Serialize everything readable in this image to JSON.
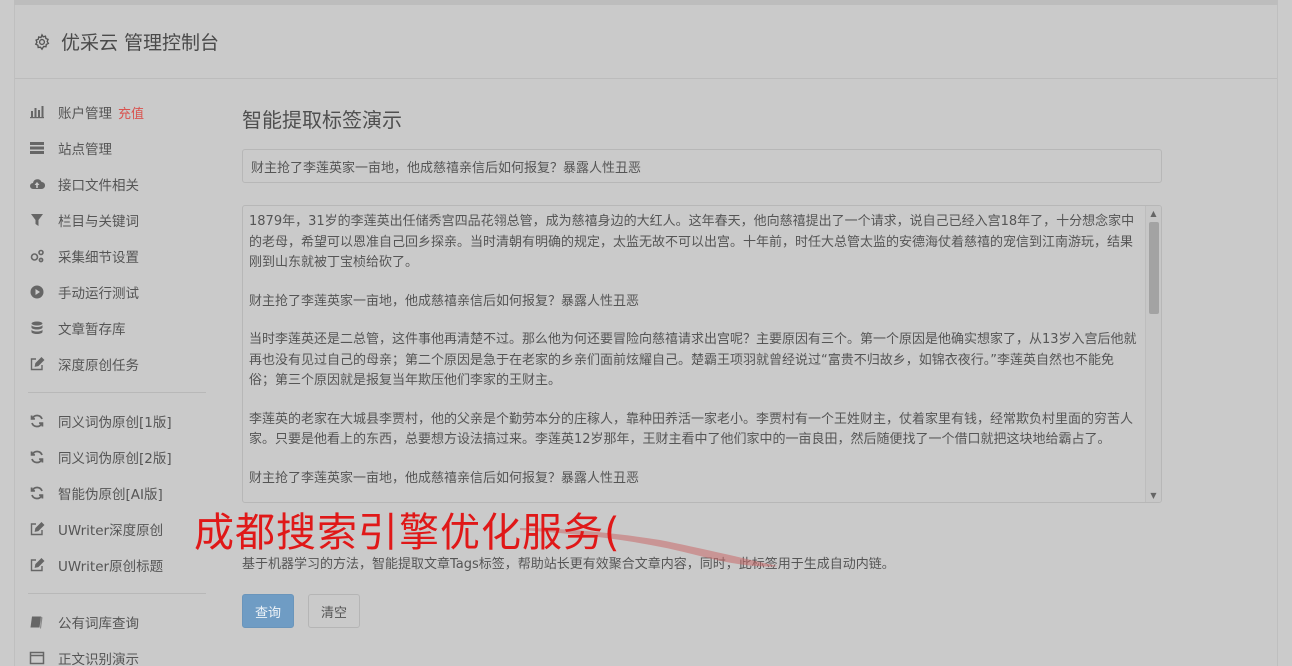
{
  "header": {
    "title": "优采云 管理控制台"
  },
  "sidebar": {
    "group1": [
      {
        "label": "账户管理",
        "badge": "充值",
        "icon": "bar-chart-icon"
      },
      {
        "label": "站点管理",
        "icon": "list-icon"
      },
      {
        "label": "接口文件相关",
        "icon": "cloud-upload-icon"
      },
      {
        "label": "栏目与关键词",
        "icon": "filter-icon"
      },
      {
        "label": "采集细节设置",
        "icon": "gears-icon"
      },
      {
        "label": "手动运行测试",
        "icon": "play-circle-icon"
      },
      {
        "label": "文章暂存库",
        "icon": "database-icon"
      },
      {
        "label": "深度原创任务",
        "icon": "edit-icon"
      }
    ],
    "group2": [
      {
        "label": "同义词伪原创[1版]",
        "icon": "refresh-icon"
      },
      {
        "label": "同义词伪原创[2版]",
        "icon": "refresh-icon"
      },
      {
        "label": "智能伪原创[AI版]",
        "icon": "refresh-icon"
      },
      {
        "label": "UWriter深度原创",
        "icon": "edit-icon"
      },
      {
        "label": "UWriter原创标题",
        "icon": "edit-icon"
      }
    ],
    "group3": [
      {
        "label": "公有词库查询",
        "icon": "book-icon"
      },
      {
        "label": "正文识别演示",
        "icon": "window-icon"
      }
    ]
  },
  "main": {
    "page_title": "智能提取标签演示",
    "title_value": "财主抢了李莲英家一亩地，他成慈禧亲信后如何报复？暴露人性丑恶",
    "content_paragraphs": [
      "1879年，31岁的李莲英出任储秀宫四品花翎总管，成为慈禧身边的大红人。这年春天，他向慈禧提出了一个请求，说自己已经入宫18年了，十分想念家中的老母，希望可以恩准自己回乡探亲。当时清朝有明确的规定，太监无故不可以出宫。十年前，时任大总管太监的安德海仗着慈禧的宠信到江南游玩，结果刚到山东就被丁宝桢给砍了。",
      "财主抢了李莲英家一亩地，他成慈禧亲信后如何报复？暴露人性丑恶",
      "当时李莲英还是二总管，这件事他再清楚不过。那么他为何还要冒险向慈禧请求出宫呢？主要原因有三个。第一个原因是他确实想家了，从13岁入宫后他就再也没有见过自己的母亲；第二个原因是急于在老家的乡亲们面前炫耀自己。楚霸王项羽就曾经说过“富贵不归故乡，如锦衣夜行。”李莲英自然也不能免俗；第三个原因就是报复当年欺压他们李家的王财主。",
      "李莲英的老家在大城县李贾村，他的父亲是个勤劳本分的庄稼人，靠种田养活一家老小。李贾村有一个王姓财主，仗着家里有钱，经常欺负村里面的穷苦人家。只要是他看上的东西，总要想方设法搞过来。李莲英12岁那年，王财主看中了他们家中的一亩良田，然后随便找了一个借口就把这块地给霸占了。",
      "财主抢了李莲英家一亩地，他成慈禧亲信后如何报复？暴露人性丑恶"
    ],
    "description": "基于机器学习的方法，智能提取文章Tags标签，帮助站长更有效聚合文章内容，同时，此标签用于生成自动内链。",
    "query_button": "查询",
    "clear_button": "清空"
  },
  "overlay": {
    "text": "成都搜索引擎优化服务("
  }
}
